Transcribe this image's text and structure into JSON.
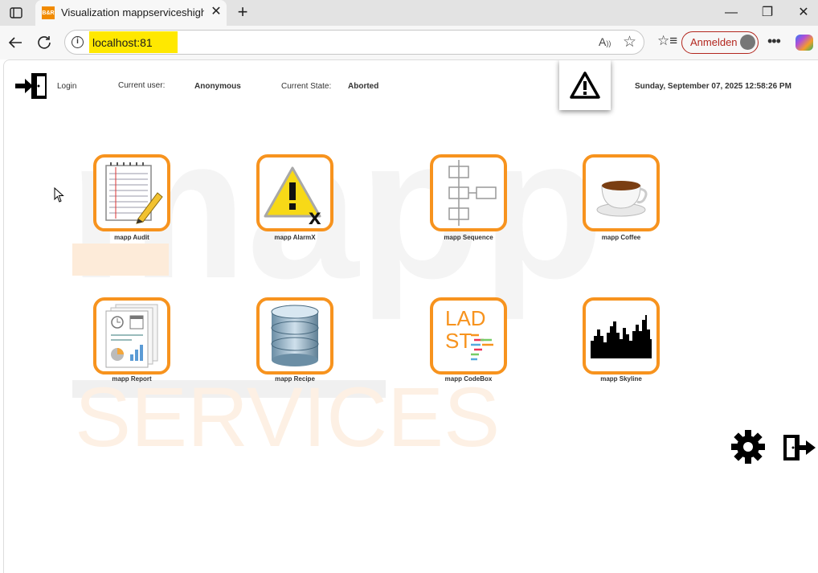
{
  "browser": {
    "tab_title": "Visualization mappserviceshighlig",
    "tab_favicon_text": "B&R",
    "url": "localhost:81",
    "signin_label": "Anmelden"
  },
  "header": {
    "login_label": "Login",
    "current_user_label": "Current user:",
    "current_user_value": "Anonymous",
    "current_state_label": "Current State:",
    "current_state_value": "Aborted",
    "datetime": "Sunday, September 07, 2025 12:58:26 PM"
  },
  "watermark": {
    "word1": "mapp",
    "word2": "SERVICES"
  },
  "tiles": [
    {
      "label": "mapp Audit",
      "icon": "notepad-pencil-icon"
    },
    {
      "label": "mapp AlarmX",
      "icon": "warning-x-icon"
    },
    {
      "label": "mapp Sequence",
      "icon": "flowchart-icon"
    },
    {
      "label": "mapp Coffee",
      "icon": "coffee-cup-icon"
    },
    {
      "label": "mapp Report",
      "icon": "report-documents-icon"
    },
    {
      "label": "mapp Recipe",
      "icon": "database-icon"
    },
    {
      "label": "mapp CodeBox",
      "icon": "ladder-st-code-icon",
      "icon_text_1": "LAD",
      "icon_text_2": "ST"
    },
    {
      "label": "mapp Skyline",
      "icon": "city-skyline-icon"
    }
  ],
  "colors": {
    "tile_border": "#f7931e",
    "signin_accent": "#b3261e",
    "url_highlight": "#ffe800"
  }
}
